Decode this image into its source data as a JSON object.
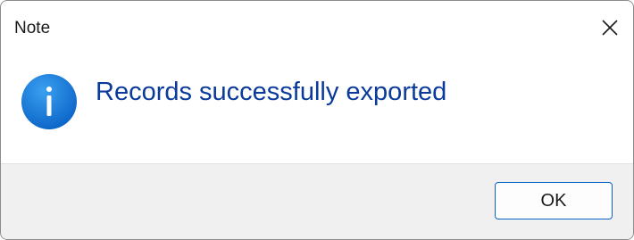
{
  "dialog": {
    "title": "Note",
    "close_icon": "close-icon",
    "message": "Records successfully exported",
    "message_icon": "info-icon",
    "ok_label": "OK"
  },
  "colors": {
    "message_text": "#0a3a9a",
    "info_icon_fill": "#0f74d8",
    "ok_border": "#0a64c8",
    "footer_bg": "#f0f0f0"
  }
}
